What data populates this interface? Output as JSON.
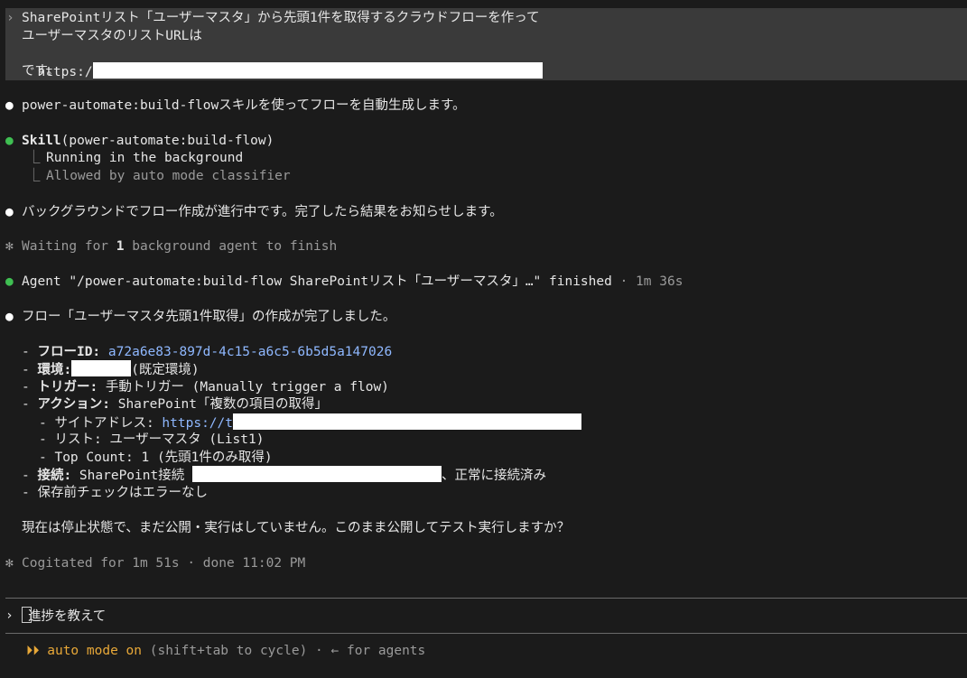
{
  "user_prompt": {
    "chevron": "›",
    "line1": "SharePointリスト「ユーザーマスタ」から先頭1件を取得するクラウドフローを作って",
    "line2": "ユーザーマスタのリストURLは",
    "line3_prefix": "https:/",
    "line4": "です。"
  },
  "messages": {
    "bullet": "●",
    "star": "✻",
    "m1": "power-automate:build-flowスキルを使ってフローを自動生成します。",
    "skill_name": "Skill",
    "skill_arg": "(power-automate:build-flow)",
    "tree_glyph": "⎿",
    "skill_status1": "Running in the background",
    "skill_status2": "Allowed by auto mode classifier",
    "m2": "バックグラウンドでフロー作成が進行中です。完了したら結果をお知らせします。",
    "waiting_prefix": "Waiting for ",
    "waiting_count": "1",
    "waiting_suffix": " background agent to finish",
    "agent_text": "Agent \"/power-automate:build-flow SharePointリスト「ユーザーマスタ」…\" finished",
    "agent_time": " · 1m 36s",
    "m3": "フロー「ユーザーマスタ先頭1件取得」の作成が完了しました。"
  },
  "details": {
    "dash": "-",
    "flow_id_label": "フローID:",
    "flow_id_value": "a72a6e83-897d-4c15-a6c5-6b5d5a147026",
    "env_label": "環境:",
    "env_suffix": "(既定環境)",
    "trigger_label": "トリガー:",
    "trigger_value": " 手動トリガー (Manually trigger a flow)",
    "action_label": "アクション:",
    "action_value": " SharePoint「複数の項目の取得」",
    "site_label": "- サイトアドレス: ",
    "site_value_prefix": "https://t",
    "list_line": "- リスト: ユーザーマスタ (List1)",
    "top_line": "- Top Count: 1 (先頭1件のみ取得)",
    "conn_label": "接続:",
    "conn_value_prefix": " SharePoint接続 ",
    "conn_value_suffix": "、正常に接続済み",
    "check_line": "保存前チェックはエラーなし",
    "question": "現在は停止状態で、まだ公開・実行はしていません。このまま公開してテスト実行しますか？"
  },
  "status": {
    "cogitated": "Cogitated for 1m 51s · done 11:02 PM"
  },
  "input": {
    "chevron": "›",
    "text": "進捗を教えて"
  },
  "footer": {
    "arrows": "⏵⏵",
    "mode": "auto mode on",
    "hint": " (shift+tab to cycle) · ← for agents"
  },
  "colors": {
    "background": "#1b1b1b",
    "prompt_block": "#3a3a3a",
    "bullet_green": "#3fbf52",
    "link_blue": "#8fb8ff",
    "mode_orange": "#e8a838"
  }
}
